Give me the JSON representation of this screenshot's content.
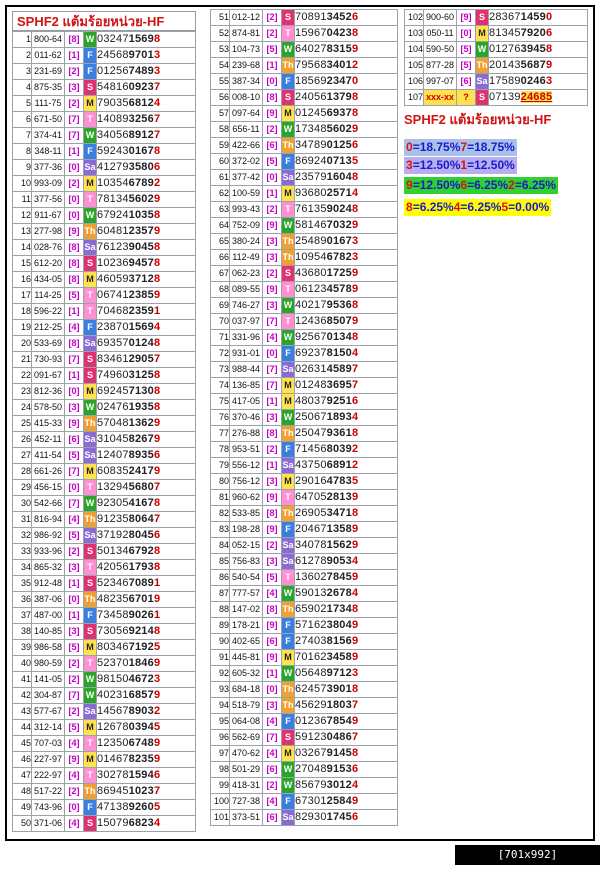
{
  "title": "SPHF2 แต้มร้อยหน่วย-HF",
  "title2": "SPHF2 แต้มร้อยหน่วย-HF",
  "footer": "[701x992] http://upic.me/",
  "day_colors": {
    "W": "#2aa52a",
    "F": "#3a7ee0",
    "M": "#ffe14d",
    "S": "#e0326e",
    "T": "#ff8fd0",
    "Sa": "#8a6bd4",
    "Th": "#f0a030",
    "?": "#ffe14d"
  },
  "rows": [
    [
      "1",
      "800-64",
      "[8]",
      "W",
      "0324715698"
    ],
    [
      "2",
      "011-62",
      "[1]",
      "F",
      "2456897013"
    ],
    [
      "3",
      "231-69",
      "[2]",
      "F",
      "0125674893"
    ],
    [
      "4",
      "875-35",
      "[3]",
      "S",
      "5481609237"
    ],
    [
      "5",
      "111-75",
      "[2]",
      "M",
      "7903568124"
    ],
    [
      "6",
      "671-50",
      "[7]",
      "T",
      "1408932567"
    ],
    [
      "7",
      "374-41",
      "[7]",
      "W",
      "3405689127"
    ],
    [
      "8",
      "348-11",
      "[1]",
      "F",
      "5924301678"
    ],
    [
      "9",
      "377-36",
      "[0]",
      "Sa",
      "4127935806"
    ],
    [
      "10",
      "993-09",
      "[2]",
      "M",
      "1035467892"
    ],
    [
      "11",
      "377-56",
      "[0]",
      "T",
      "7813456029"
    ],
    [
      "12",
      "911-67",
      "[0]",
      "W",
      "6792410358"
    ],
    [
      "13",
      "277-98",
      "[9]",
      "Th",
      "6048123579"
    ],
    [
      "14",
      "028-76",
      "[8]",
      "Sa",
      "7612390458"
    ],
    [
      "15",
      "612-20",
      "[8]",
      "S",
      "1023694578"
    ],
    [
      "16",
      "434-05",
      "[8]",
      "M",
      "4605937128"
    ],
    [
      "17",
      "114-25",
      "[5]",
      "T",
      "0674123859"
    ],
    [
      "18",
      "596-22",
      "[1]",
      "T",
      "7046823591"
    ],
    [
      "19",
      "212-25",
      "[4]",
      "F",
      "2387015694"
    ],
    [
      "20",
      "533-69",
      "[8]",
      "Sa",
      "6935701248"
    ],
    [
      "21",
      "730-93",
      "[7]",
      "S",
      "8346129057"
    ],
    [
      "22",
      "091-67",
      "[1]",
      "S",
      "7496031258"
    ],
    [
      "23",
      "812-36",
      "[0]",
      "M",
      "6924571308"
    ],
    [
      "24",
      "578-50",
      "[3]",
      "W",
      "0247619358"
    ],
    [
      "25",
      "415-33",
      "[9]",
      "Th",
      "5704813629"
    ],
    [
      "26",
      "452-11",
      "[6]",
      "Sa",
      "3104582679"
    ],
    [
      "27",
      "411-54",
      "[5]",
      "Sa",
      "1240789356"
    ],
    [
      "28",
      "661-26",
      "[7]",
      "M",
      "6083524179"
    ],
    [
      "29",
      "456-15",
      "[0]",
      "T",
      "1329456807"
    ],
    [
      "30",
      "542-66",
      "[7]",
      "W",
      "9230541678"
    ],
    [
      "31",
      "816-94",
      "[4]",
      "Th",
      "9123580647"
    ],
    [
      "32",
      "986-92",
      "[5]",
      "Sa",
      "3719280456"
    ],
    [
      "33",
      "933-96",
      "[2]",
      "S",
      "5013467928"
    ],
    [
      "34",
      "865-32",
      "[3]",
      "T",
      "4205617938"
    ],
    [
      "35",
      "912-48",
      "[1]",
      "S",
      "5234670891"
    ],
    [
      "36",
      "387-06",
      "[0]",
      "Th",
      "4823567019"
    ],
    [
      "37",
      "487-00",
      "[1]",
      "F",
      "7345890261"
    ],
    [
      "38",
      "140-85",
      "[3]",
      "S",
      "7305692148"
    ],
    [
      "39",
      "986-58",
      "[5]",
      "M",
      "8034671925"
    ],
    [
      "40",
      "980-59",
      "[2]",
      "T",
      "5237018469"
    ],
    [
      "41",
      "141-05",
      "[2]",
      "W",
      "9815046723"
    ],
    [
      "42",
      "304-87",
      "[7]",
      "W",
      "4023168579"
    ],
    [
      "43",
      "577-67",
      "[2]",
      "Sa",
      "1456789032"
    ],
    [
      "44",
      "312-14",
      "[5]",
      "M",
      "1267803945"
    ],
    [
      "45",
      "707-03",
      "[4]",
      "T",
      "1235067489"
    ],
    [
      "46",
      "227-97",
      "[9]",
      "M",
      "0146782359"
    ],
    [
      "47",
      "222-97",
      "[4]",
      "T",
      "3027815946"
    ],
    [
      "48",
      "517-22",
      "[2]",
      "Th",
      "8694510237"
    ],
    [
      "49",
      "743-96",
      "[0]",
      "F",
      "4713892605"
    ],
    [
      "50",
      "371-06",
      "[4]",
      "S",
      "1507968234"
    ],
    [
      "51",
      "012-12",
      "[2]",
      "S",
      "7089134526"
    ],
    [
      "52",
      "874-81",
      "[2]",
      "T",
      "1596704238"
    ],
    [
      "53",
      "104-73",
      "[5]",
      "W",
      "6402783159"
    ],
    [
      "54",
      "239-68",
      "[1]",
      "Th",
      "7956834012"
    ],
    [
      "55",
      "387-34",
      "[0]",
      "F",
      "1856923470"
    ],
    [
      "56",
      "008-10",
      "[8]",
      "S",
      "2405613798"
    ],
    [
      "57",
      "097-64",
      "[9]",
      "M",
      "0124569378"
    ],
    [
      "58",
      "656-11",
      "[2]",
      "W",
      "1734856029"
    ],
    [
      "59",
      "422-66",
      "[6]",
      "Th",
      "3478901256"
    ],
    [
      "60",
      "372-02",
      "[5]",
      "F",
      "8692407135"
    ],
    [
      "61",
      "377-42",
      "[0]",
      "Sa",
      "2357916048"
    ],
    [
      "62",
      "100-59",
      "[1]",
      "M",
      "9368025714"
    ],
    [
      "63",
      "993-43",
      "[2]",
      "T",
      "7613590248"
    ],
    [
      "64",
      "752-09",
      "[9]",
      "W",
      "5814670329"
    ],
    [
      "65",
      "380-24",
      "[3]",
      "Th",
      "2548901673"
    ],
    [
      "66",
      "112-49",
      "[3]",
      "Th",
      "1095467823"
    ],
    [
      "67",
      "062-23",
      "[2]",
      "S",
      "4368017259"
    ],
    [
      "68",
      "089-55",
      "[9]",
      "T",
      "0612345789"
    ],
    [
      "69",
      "746-27",
      "[3]",
      "W",
      "4021795368"
    ],
    [
      "70",
      "037-97",
      "[7]",
      "T",
      "1243685079"
    ],
    [
      "71",
      "331-96",
      "[4]",
      "W",
      "9256701348"
    ],
    [
      "72",
      "931-01",
      "[0]",
      "F",
      "6923781504"
    ],
    [
      "73",
      "988-44",
      "[7]",
      "Sa",
      "0263145897"
    ],
    [
      "74",
      "136-85",
      "[7]",
      "M",
      "0124836957"
    ],
    [
      "75",
      "417-05",
      "[1]",
      "M",
      "4803792516"
    ],
    [
      "76",
      "370-46",
      "[3]",
      "W",
      "2506718934"
    ],
    [
      "77",
      "276-88",
      "[8]",
      "Th",
      "2504793618"
    ],
    [
      "78",
      "953-51",
      "[2]",
      "F",
      "7145680392"
    ],
    [
      "79",
      "556-12",
      "[1]",
      "Sa",
      "4375068912"
    ],
    [
      "80",
      "756-12",
      "[3]",
      "M",
      "2901647835"
    ],
    [
      "81",
      "960-62",
      "[9]",
      "T",
      "6470528139"
    ],
    [
      "82",
      "533-85",
      "[8]",
      "Th",
      "2690534718"
    ],
    [
      "83",
      "198-28",
      "[9]",
      "F",
      "2046713589"
    ],
    [
      "84",
      "052-15",
      "[2]",
      "Sa",
      "3407815629"
    ],
    [
      "85",
      "756-83",
      "[3]",
      "Sa",
      "6127890534"
    ],
    [
      "86",
      "540-54",
      "[5]",
      "T",
      "1360278459"
    ],
    [
      "87",
      "777-57",
      "[4]",
      "W",
      "5901326784"
    ],
    [
      "88",
      "147-02",
      "[8]",
      "Th",
      "6590217348"
    ],
    [
      "89",
      "178-21",
      "[9]",
      "F",
      "5716238049"
    ],
    [
      "90",
      "402-65",
      "[6]",
      "F",
      "2740381569"
    ],
    [
      "91",
      "445-81",
      "[9]",
      "M",
      "7016234589"
    ],
    [
      "92",
      "605-32",
      "[1]",
      "W",
      "0564897123"
    ],
    [
      "93",
      "684-18",
      "[0]",
      "Th",
      "6245739018"
    ],
    [
      "94",
      "518-79",
      "[3]",
      "Th",
      "4562918037"
    ],
    [
      "95",
      "064-08",
      "[4]",
      "F",
      "0123678549"
    ],
    [
      "96",
      "562-69",
      "[7]",
      "S",
      "5912304867"
    ],
    [
      "97",
      "470-62",
      "[4]",
      "M",
      "0326791458"
    ],
    [
      "98",
      "501-29",
      "[6]",
      "W",
      "2704891536"
    ],
    [
      "99",
      "418-31",
      "[2]",
      "W",
      "8567930124"
    ],
    [
      "100",
      "727-38",
      "[4]",
      "F",
      "6730125849"
    ],
    [
      "101",
      "373-51",
      "[6]",
      "Sa",
      "8293017456"
    ],
    [
      "102",
      "900-60",
      "[9]",
      "S",
      "2836714590"
    ],
    [
      "103",
      "050-11",
      "[0]",
      "M",
      "8134579206"
    ],
    [
      "104",
      "590-50",
      "[5]",
      "W",
      "0127639458"
    ],
    [
      "105",
      "877-28",
      "[5]",
      "Th",
      "2014356879"
    ],
    [
      "106",
      "997-07",
      "[6]",
      "Sa",
      "1758902463"
    ],
    [
      "107",
      "xxx-xx",
      "?",
      "S",
      "0713924685"
    ]
  ],
  "percentages": [
    [
      {
        "k": "0",
        "v": "=18.75%"
      },
      {
        "k": "7",
        "v": "=18.75%"
      }
    ],
    [
      {
        "k": "3",
        "v": "=12.50%"
      },
      {
        "k": "1",
        "v": "=12.50%"
      }
    ],
    [
      {
        "k": "9",
        "v": "=12.50%"
      },
      {
        "k": "6",
        "v": "=6.25%"
      },
      {
        "k": "2",
        "v": "=6.25%"
      }
    ],
    [
      {
        "k": "8",
        "v": "=6.25%"
      },
      {
        "k": "4",
        "v": "=6.25%"
      },
      {
        "k": "5",
        "v": "=0.00%"
      }
    ]
  ],
  "pct_colors": [
    "#a9c0ea",
    "#b7aef0",
    "#2fd02f",
    "#ffff00"
  ]
}
